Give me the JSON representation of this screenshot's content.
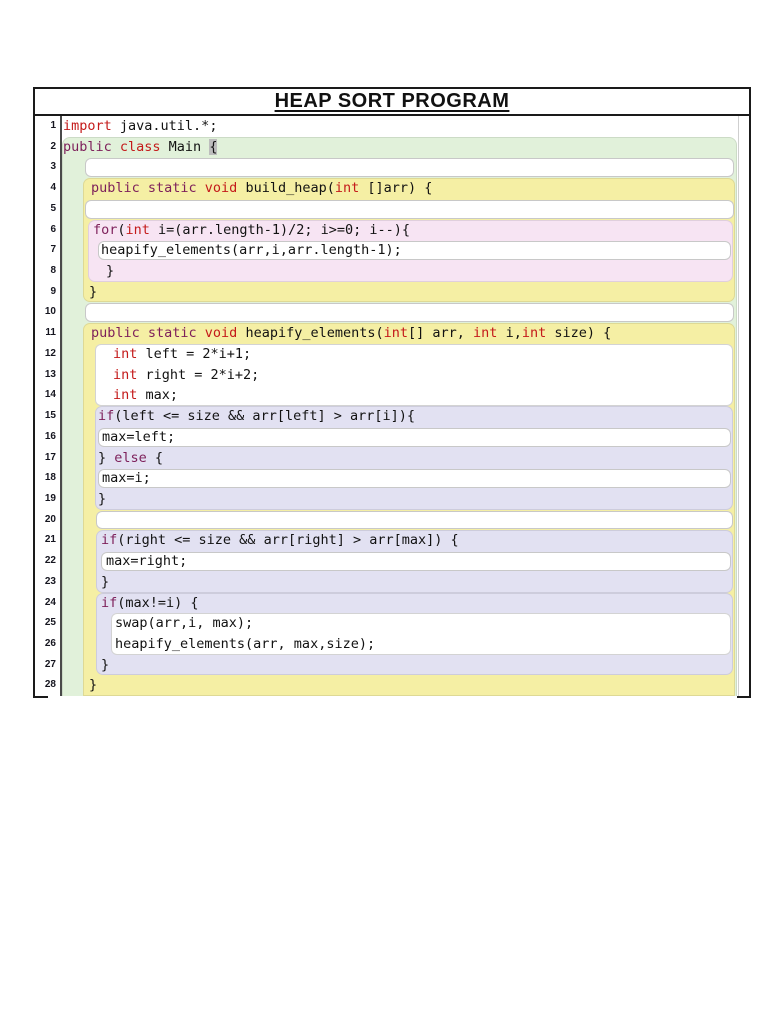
{
  "title": "HEAP SORT PROGRAM",
  "colors": {
    "class_scope": "#e1f1da",
    "method_scope": "#f5efa4",
    "loop_scope": "#f7e4f3",
    "conditional_scope": "#e2e1f2",
    "keyword_type": "#c41a1a",
    "keyword_stmt": "#7d1f5a",
    "bracket_highlight": "#bdbdbd",
    "frame_border": "#1a1a1a"
  },
  "code": {
    "language": "java",
    "lines": [
      {
        "n": 1,
        "slot": "pre",
        "pad": 1,
        "tokens": [
          {
            "c": "r",
            "t": "import"
          },
          {
            "c": "p",
            "t": " java.util.*;"
          }
        ]
      },
      {
        "n": 2,
        "slot": "g1",
        "pad": 1,
        "tokens": [
          {
            "c": "m",
            "t": "public "
          },
          {
            "c": "r",
            "t": "class"
          },
          {
            "c": "p",
            "t": " Main "
          },
          {
            "c": "hl",
            "t": "{"
          }
        ]
      },
      {
        "n": 3,
        "slot": "g1",
        "type": "box",
        "ml": 23,
        "mr": 3,
        "pad": 0,
        "tokens": []
      },
      {
        "n": 4,
        "slot": "y1a",
        "pad": 8,
        "tokens": [
          {
            "c": "m",
            "t": "public static "
          },
          {
            "c": "r",
            "t": "void"
          },
          {
            "c": "p",
            "t": " build_heap("
          },
          {
            "c": "r",
            "t": "int"
          },
          {
            "c": "p",
            "t": " []arr) {"
          }
        ]
      },
      {
        "n": 5,
        "slot": "y1a",
        "type": "box",
        "ml": 2,
        "mr": 1,
        "pad": 0,
        "tokens": []
      },
      {
        "n": 6,
        "slot": "p1",
        "pad": 5,
        "tokens": [
          {
            "c": "m",
            "t": "for"
          },
          {
            "c": "p",
            "t": "("
          },
          {
            "c": "r",
            "t": "int"
          },
          {
            "c": "p",
            "t": " i=(arr.length-1)/2; i>=0; i--){"
          }
        ]
      },
      {
        "n": 7,
        "slot": "p1",
        "type": "box",
        "ml": 10,
        "mr": 2,
        "pad": 3,
        "tokens": [
          {
            "c": "p",
            "t": "heapify_elements(arr,i,arr.length-1);"
          }
        ]
      },
      {
        "n": 8,
        "slot": "p1",
        "pad": 18,
        "tokens": [
          {
            "c": "p",
            "t": "}"
          }
        ]
      },
      {
        "n": 9,
        "slot": "y1b",
        "pad": 6,
        "tokens": [
          {
            "c": "p",
            "t": "}"
          }
        ]
      },
      {
        "n": 10,
        "slot": "g2",
        "type": "box",
        "ml": 23,
        "mr": 3,
        "pad": 0,
        "tokens": []
      },
      {
        "n": 11,
        "slot": "y2a",
        "pad": 8,
        "tokens": [
          {
            "c": "m",
            "t": "public static "
          },
          {
            "c": "r",
            "t": "void"
          },
          {
            "c": "p",
            "t": " heapify_elements("
          },
          {
            "c": "r",
            "t": "int"
          },
          {
            "c": "p",
            "t": "[] arr, "
          },
          {
            "c": "r",
            "t": "int"
          },
          {
            "c": "p",
            "t": " i,"
          },
          {
            "c": "r",
            "t": "int"
          },
          {
            "c": "p",
            "t": " size) {"
          }
        ]
      },
      {
        "n": 12,
        "slot": "w1",
        "pad": 18,
        "tokens": [
          {
            "c": "r",
            "t": "int"
          },
          {
            "c": "p",
            "t": " left = 2*i+1;"
          }
        ]
      },
      {
        "n": 13,
        "slot": "w1",
        "pad": 18,
        "tokens": [
          {
            "c": "r",
            "t": "int"
          },
          {
            "c": "p",
            "t": " right = 2*i+2;"
          }
        ]
      },
      {
        "n": 14,
        "slot": "w1",
        "pad": 18,
        "tokens": [
          {
            "c": "r",
            "t": "int"
          },
          {
            "c": "p",
            "t": " max;"
          }
        ]
      },
      {
        "n": 15,
        "slot": "l1",
        "pad": 3,
        "tokens": [
          {
            "c": "m",
            "t": "if"
          },
          {
            "c": "p",
            "t": "(left <= size && arr[left] > arr[i]){"
          }
        ]
      },
      {
        "n": 16,
        "slot": "l1",
        "type": "box",
        "ml": 3,
        "mr": 2,
        "pad": 4,
        "tokens": [
          {
            "c": "p",
            "t": "max=left;"
          }
        ]
      },
      {
        "n": 17,
        "slot": "l1",
        "pad": 3,
        "tokens": [
          {
            "c": "p",
            "t": "} "
          },
          {
            "c": "m",
            "t": "else"
          },
          {
            "c": "p",
            "t": " {"
          }
        ]
      },
      {
        "n": 18,
        "slot": "l1",
        "type": "box",
        "ml": 3,
        "mr": 2,
        "pad": 4,
        "tokens": [
          {
            "c": "p",
            "t": "max=i;"
          }
        ]
      },
      {
        "n": 19,
        "slot": "l1",
        "pad": 3,
        "tokens": [
          {
            "c": "p",
            "t": "}"
          }
        ]
      },
      {
        "n": 20,
        "slot": "y2b",
        "type": "box",
        "ml": 13,
        "mr": 2,
        "pad": 0,
        "tokens": []
      },
      {
        "n": 21,
        "slot": "l2",
        "pad": 5,
        "tokens": [
          {
            "c": "m",
            "t": "if"
          },
          {
            "c": "p",
            "t": "(right <= size && arr[right] > arr[max]) {"
          }
        ]
      },
      {
        "n": 22,
        "slot": "l2",
        "type": "box",
        "ml": 5,
        "mr": 2,
        "pad": 5,
        "tokens": [
          {
            "c": "p",
            "t": "max=right;"
          }
        ]
      },
      {
        "n": 23,
        "slot": "l2",
        "pad": 5,
        "tokens": [
          {
            "c": "p",
            "t": "}"
          }
        ]
      },
      {
        "n": 24,
        "slot": "l3a",
        "pad": 5,
        "tokens": [
          {
            "c": "m",
            "t": "if"
          },
          {
            "c": "p",
            "t": "(max!=i) {"
          }
        ]
      },
      {
        "n": 25,
        "slot": "w2",
        "pad": 4,
        "tokens": [
          {
            "c": "p",
            "t": "swap(arr,i, max);"
          }
        ]
      },
      {
        "n": 26,
        "slot": "w2",
        "pad": 4,
        "tokens": [
          {
            "c": "p",
            "t": "heapify_elements(arr, max,size);"
          }
        ]
      },
      {
        "n": 27,
        "slot": "l3b",
        "pad": 5,
        "tokens": [
          {
            "c": "p",
            "t": "}"
          }
        ]
      },
      {
        "n": 28,
        "slot": "y2c",
        "pad": 6,
        "tokens": [
          {
            "c": "p",
            "t": "}"
          }
        ]
      }
    ]
  }
}
